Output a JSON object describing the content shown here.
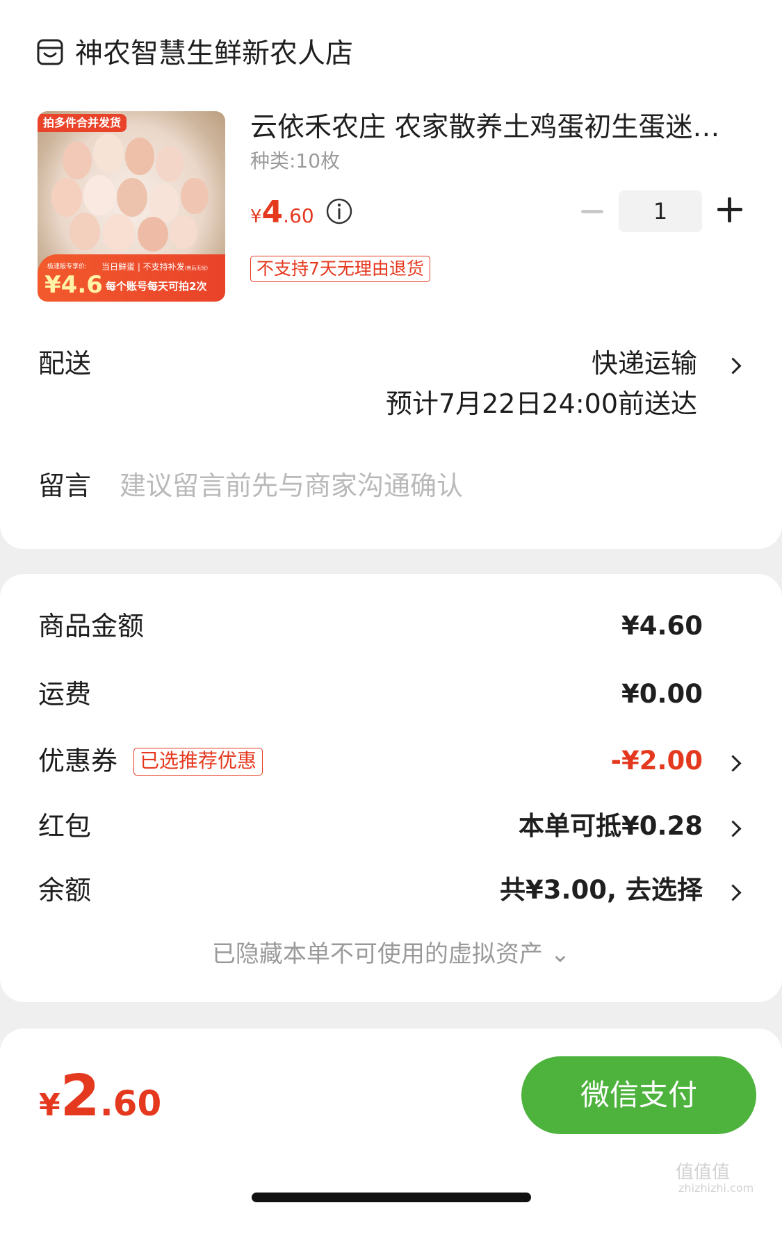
{
  "store": {
    "name": "神农智慧生鲜新农人店",
    "icon": "store-icon"
  },
  "product": {
    "title": "云依禾农庄 农家散养土鸡蛋初生蛋迷你鸡蛋",
    "spec": "种类:10枚",
    "price_yen": "¥",
    "price_int": "4",
    "price_dec": ".60",
    "quantity": "1",
    "return_policy": "不支持7天无理由退货",
    "image": {
      "badge_top": "拍多件合并发货",
      "small_label": "极速版专享价:",
      "price": "¥4.6",
      "line1": "当日鲜蛋 | 不支持补发",
      "line1_small": "(售后无忧)",
      "line2": "每个账号每天可拍2次"
    }
  },
  "delivery": {
    "label": "配送",
    "method": "快递运输",
    "eta": "预计7月22日24:00前送达"
  },
  "message": {
    "label": "留言",
    "placeholder": "建议留言前先与商家沟通确认"
  },
  "summary": {
    "goods_label": "商品金额",
    "goods_value": "¥4.60",
    "shipping_label": "运费",
    "shipping_value": "¥0.00",
    "coupon_label": "优惠券",
    "coupon_tag": "已选推荐优惠",
    "coupon_value": "-¥2.00",
    "redpacket_label": "红包",
    "redpacket_value": "本单可抵¥0.28",
    "balance_label": "余额",
    "balance_value": "共¥3.00, 去选择",
    "hidden_assets": "已隐藏本单不可使用的虚拟资产 ⌄"
  },
  "footer": {
    "total_yen": "¥",
    "total_int": "2",
    "total_dec": ".60",
    "pay_label": "微信支付",
    "watermark": "值值值",
    "watermark_url": "zhizhizhi.com"
  },
  "colors": {
    "accent_red": "#e5391f",
    "wechat_green": "#4db33d",
    "background": "#efefef"
  }
}
